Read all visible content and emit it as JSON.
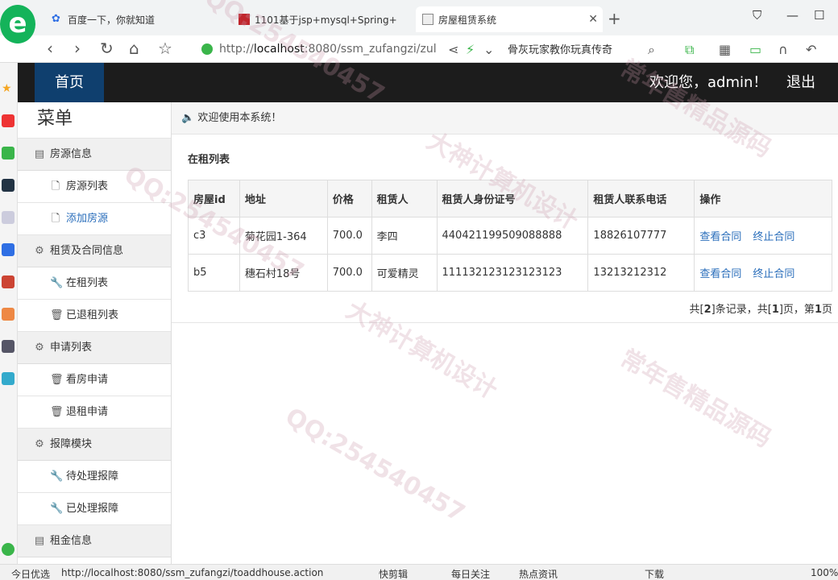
{
  "browser": {
    "tabs": [
      {
        "title": "百度一下，你就知道",
        "active": false
      },
      {
        "title": "1101基于jsp+mysql+Spring+",
        "active": false
      },
      {
        "title": "房屋租赁系统",
        "active": true
      }
    ],
    "url_prefix": "http://",
    "url_host": "localhost",
    "url_rest": ":8080/ssm_zufangzi/zul",
    "search_text": "骨灰玩家教你玩真传奇",
    "status_left": "今日优选",
    "status_url": "http://localhost:8080/ssm_zufangzi/toaddhouse.action",
    "status_items": [
      "快剪辑",
      "每日关注",
      "热点资讯",
      "下载",
      "100%"
    ]
  },
  "header": {
    "home_label": "首页",
    "welcome": "欢迎您，admin！",
    "logout_label": "退出"
  },
  "menu": {
    "title": "菜单",
    "groups": [
      {
        "label": "房源信息",
        "icon": "list-icon",
        "items": [
          {
            "label": "房源列表",
            "icon": "file-icon"
          },
          {
            "label": "添加房源",
            "icon": "file-icon"
          }
        ]
      },
      {
        "label": "租赁及合同信息",
        "icon": "gear-icon",
        "items": [
          {
            "label": "在租列表",
            "icon": "wrench-icon"
          },
          {
            "label": "已退租列表",
            "icon": "trash-icon"
          }
        ]
      },
      {
        "label": "申请列表",
        "icon": "gear-icon",
        "items": [
          {
            "label": "看房申请",
            "icon": "trash-icon"
          },
          {
            "label": "退租申请",
            "icon": "trash-icon"
          }
        ]
      },
      {
        "label": "报障模块",
        "icon": "gear-icon",
        "items": [
          {
            "label": "待处理报障",
            "icon": "wrench-icon"
          },
          {
            "label": "已处理报障",
            "icon": "wrench-icon"
          }
        ]
      },
      {
        "label": "租金信息",
        "icon": "list-icon",
        "items": []
      }
    ]
  },
  "main": {
    "notice": "欢迎使用本系统！",
    "section_title": "在租列表",
    "columns": [
      "房屋id",
      "地址",
      "价格",
      "租赁人",
      "租赁人身份证号",
      "租赁人联系电话",
      "操作"
    ],
    "rows": [
      {
        "id": "c3",
        "address": "菊花园1-364",
        "price": "700.0",
        "tenant": "李四",
        "id_card": "440421199509088888",
        "phone": "18826107777"
      },
      {
        "id": "b5",
        "address": "穗石村18号",
        "price": "700.0",
        "tenant": "可爱精灵",
        "id_card": "111132123123123123",
        "phone": "13213212312"
      }
    ],
    "op_view": "查看合同",
    "op_end": "终止合同",
    "pager": {
      "prefix": "共[",
      "total": "2",
      "mid1": "]条记录，共[",
      "pages": "1",
      "mid2": "]页，第",
      "current": "1",
      "suffix": "页"
    }
  },
  "watermark": [
    "QQ:254540457",
    "大神计算机设计",
    "常年售精品源码"
  ]
}
